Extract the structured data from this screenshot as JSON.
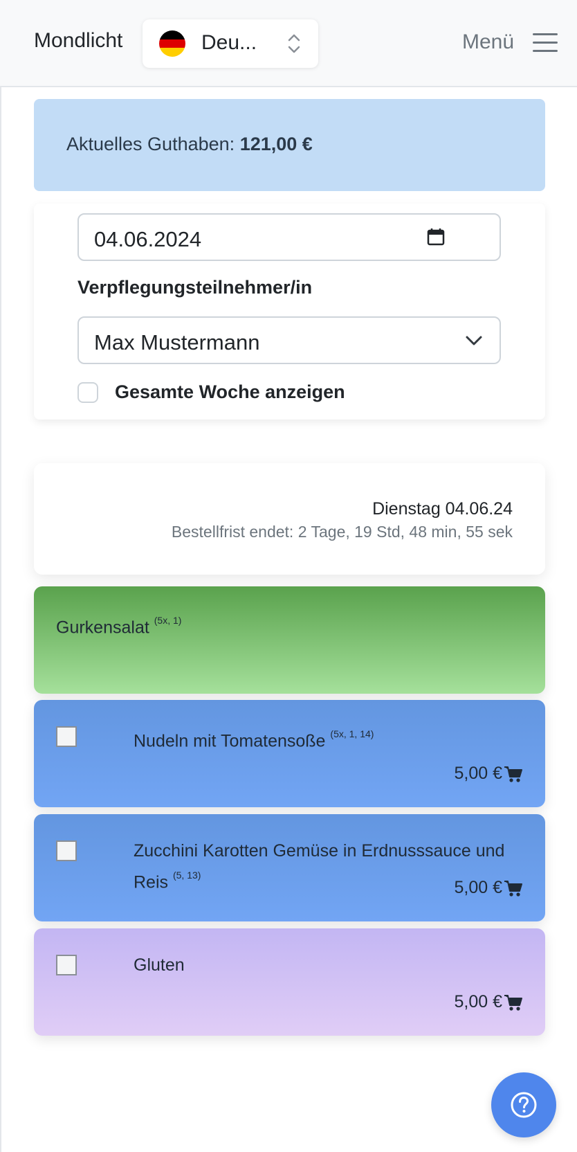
{
  "navbar": {
    "brand": "Mondlicht",
    "language_label": "Deu...",
    "menu_label": "Menü"
  },
  "balance": {
    "label": "Aktuelles Guthaben:",
    "amount": "121,00 €"
  },
  "form": {
    "date_value": "04.06.2024",
    "participant_label": "Verpflegungsteilnehmer/in",
    "participant_value": "Max Mustermann",
    "week_checkbox_label": "Gesamte Woche anzeigen",
    "week_checked": false
  },
  "day": {
    "title": "Dienstag 04.06.24",
    "deadline": "Bestellfrist endet: 2 Tage, 19 Std, 48 min, 55 sek"
  },
  "meals": [
    {
      "name": "Gurkensalat",
      "allergens": "(5x, 1)",
      "color": "#5aa24d"
    },
    {
      "name": "Nudeln mit Tomatensoße",
      "allergens": "(5x, 1, 14)",
      "price": "5,00 €",
      "checked": false,
      "color": "#6396e0"
    },
    {
      "name": "Zucchini Karotten Gemüse in Erdnusssauce und Reis",
      "allergens": "(5, 13)",
      "price": "5,00 €",
      "checked": false,
      "color": "#6396e0"
    },
    {
      "name": "Gluten",
      "allergens": "",
      "price": "5,00 €",
      "checked": false,
      "color": "#c3b6f3"
    }
  ],
  "icons": {
    "flag": "germany-flag-icon",
    "language_toggle": "updown-chevron-icon",
    "menu": "hamburger-icon",
    "date": "calendar-icon",
    "select": "chevron-down-icon",
    "cart": "cart-icon",
    "help": "help-icon"
  },
  "colors": {
    "balance_bg": "#c2dcf6",
    "help_button": "#4f86ec"
  }
}
